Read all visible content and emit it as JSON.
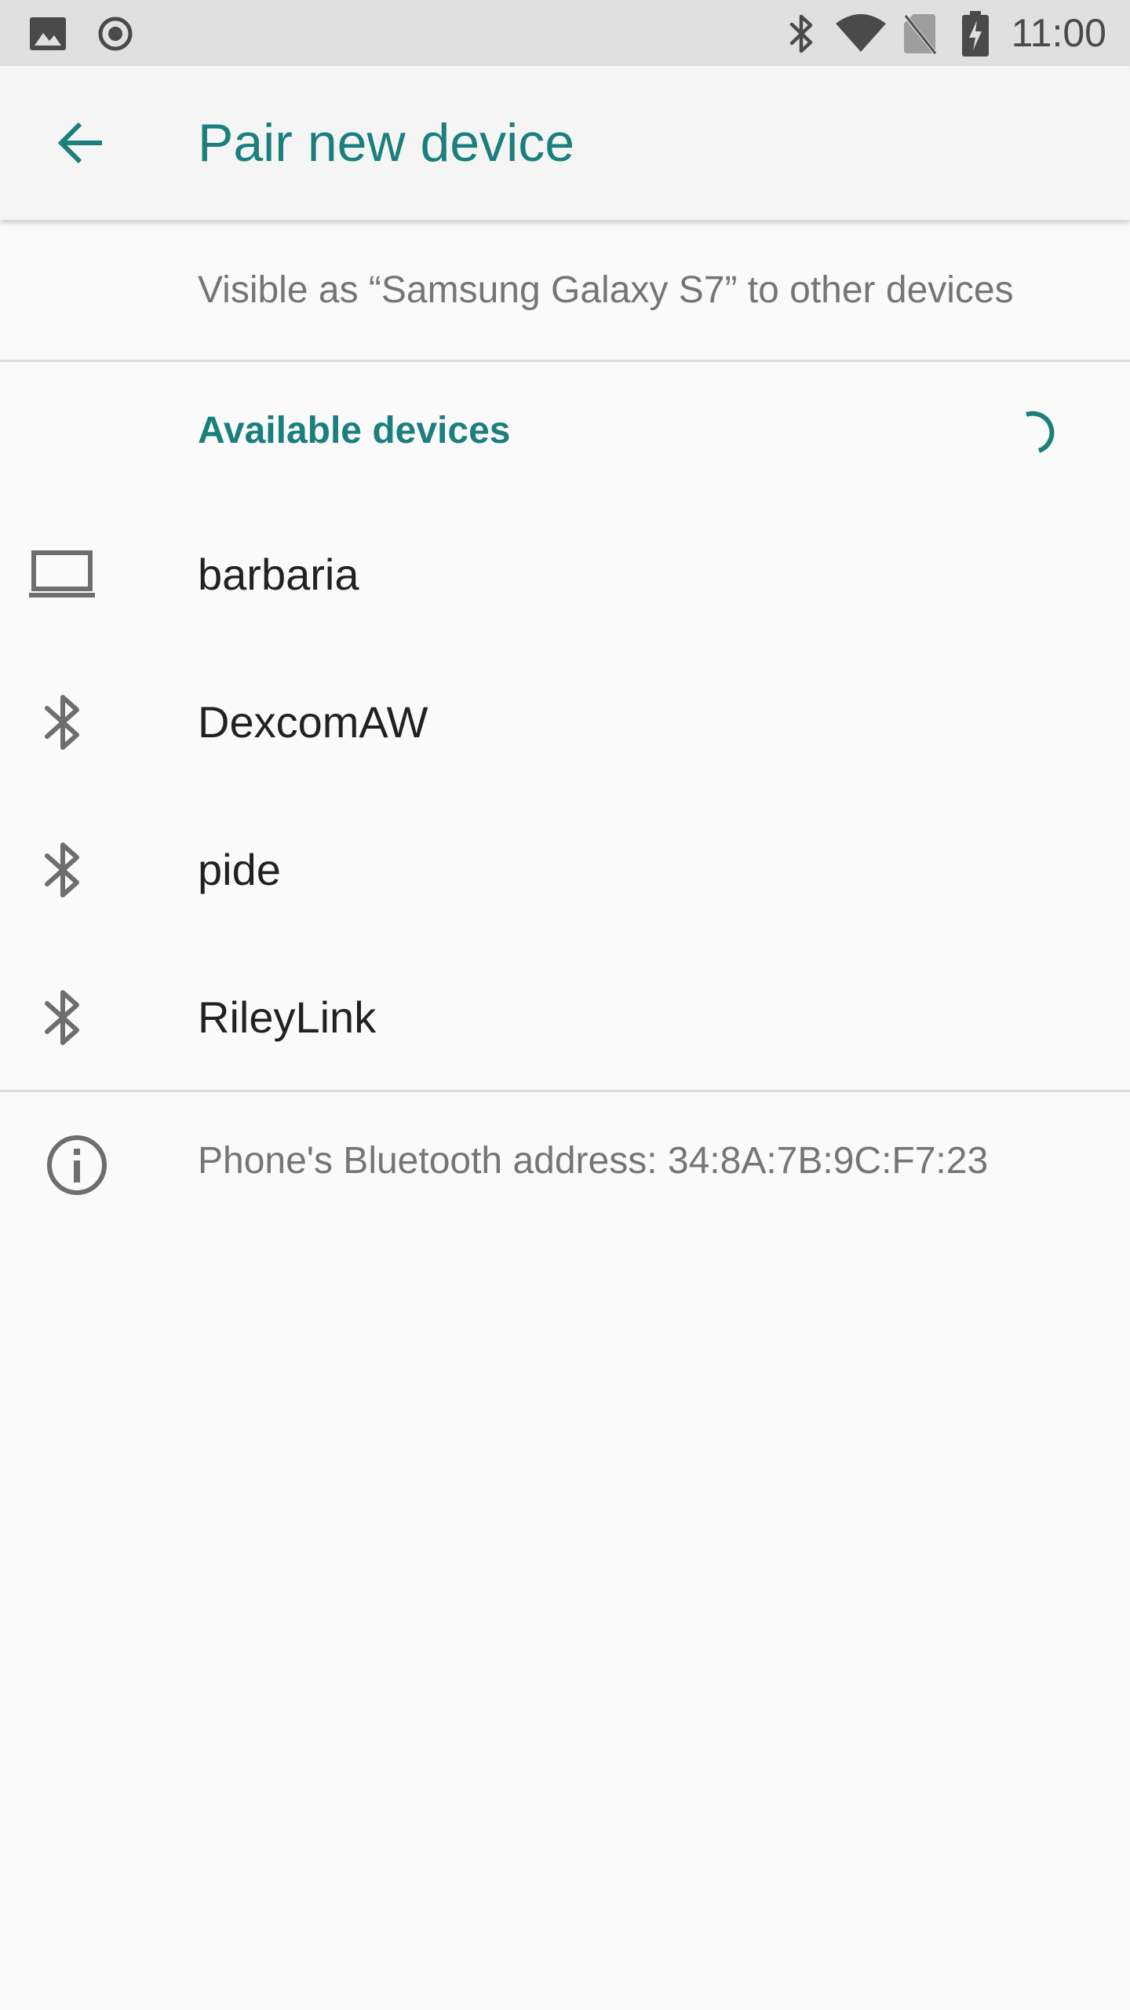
{
  "status_bar": {
    "time": "11:00",
    "left_icons": [
      "image-icon",
      "record-icon"
    ],
    "right_icons": [
      "bluetooth-icon",
      "wifi-icon",
      "no-sim-icon",
      "battery-charging-icon"
    ]
  },
  "app_bar": {
    "title": "Pair new device",
    "back_icon": "arrow-left-icon"
  },
  "visible_as": {
    "text": "Visible as “Samsung Galaxy S7” to other devices"
  },
  "available_devices": {
    "header": "Available devices",
    "devices": [
      {
        "name": "barbaria",
        "icon": "laptop-icon"
      },
      {
        "name": "DexcomAW",
        "icon": "bluetooth-icon"
      },
      {
        "name": "pide",
        "icon": "bluetooth-icon"
      },
      {
        "name": "RileyLink",
        "icon": "bluetooth-icon"
      }
    ]
  },
  "info": {
    "text": "Phone's Bluetooth address: 34:8A:7B:9C:F7:23",
    "icon": "info-icon"
  },
  "colors": {
    "accent": "#1a7f7d",
    "status_bar_bg": "#e0e0e0",
    "background": "#fafafa",
    "primary_text": "#212121",
    "secondary_text": "#757575",
    "icon_gray": "#6e6e6e"
  }
}
